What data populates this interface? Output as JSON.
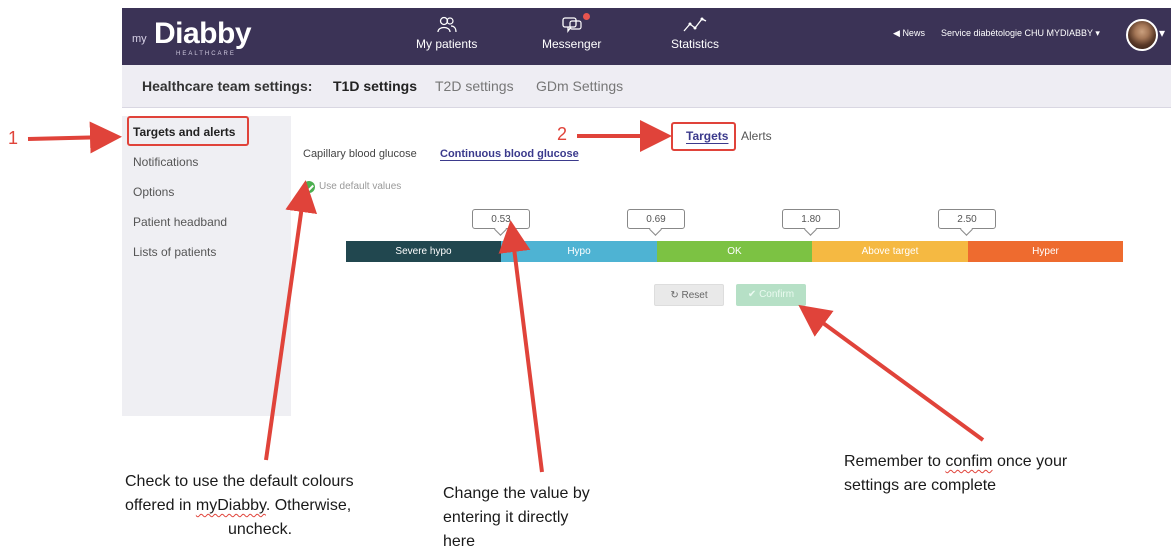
{
  "app": {
    "logo_prefix": "my",
    "logo_name": "Diabby",
    "logo_sub": "HEALTHCARE"
  },
  "nav": [
    {
      "label": "My patients",
      "icon": "patients-icon"
    },
    {
      "label": "Messenger",
      "icon": "messenger-icon"
    },
    {
      "label": "Statistics",
      "icon": "statistics-icon"
    }
  ],
  "header_right": {
    "news": "News",
    "service": "Service diabétologie CHU MYDIABBY"
  },
  "settings": {
    "title": "Healthcare team settings:",
    "tabs": [
      "T1D settings",
      "T2D settings",
      "GDm Settings"
    ],
    "active_tab": "T1D settings"
  },
  "sidebar": {
    "items": [
      "Targets and alerts",
      "Notifications",
      "Options",
      "Patient headband",
      "Lists of patients"
    ]
  },
  "content": {
    "tabs": [
      "Targets",
      "Alerts"
    ],
    "sub_tabs": [
      "Capillary blood glucose",
      "Continuous blood glucose"
    ],
    "use_default_label": "Use default values",
    "use_default_checked": true,
    "thresholds": [
      "0.53",
      "0.69",
      "1.80",
      "2.50"
    ],
    "ranges": [
      {
        "label": "Severe hypo",
        "color": "#21474f"
      },
      {
        "label": "Hypo",
        "color": "#4eb3d3"
      },
      {
        "label": "OK",
        "color": "#7cc243"
      },
      {
        "label": "Above target",
        "color": "#f5b942"
      },
      {
        "label": "Hyper",
        "color": "#ee6b2f"
      }
    ],
    "reset_label": "Reset",
    "confirm_label": "Confirm"
  },
  "annotations": {
    "num1": "1",
    "num2": "2",
    "default_note_1": "Check to use the default colours",
    "default_note_2a": "offered in ",
    "default_note_2b": "myDiabby",
    "default_note_2c": ".  Otherwise,",
    "default_note_3": "uncheck.",
    "value_note_1": "Change the value by",
    "value_note_2": "entering it directly",
    "value_note_3": "here",
    "confirm_note_1a": "Remember to ",
    "confirm_note_1b": "confim",
    "confirm_note_1c": " once your",
    "confirm_note_2": "settings are complete"
  }
}
